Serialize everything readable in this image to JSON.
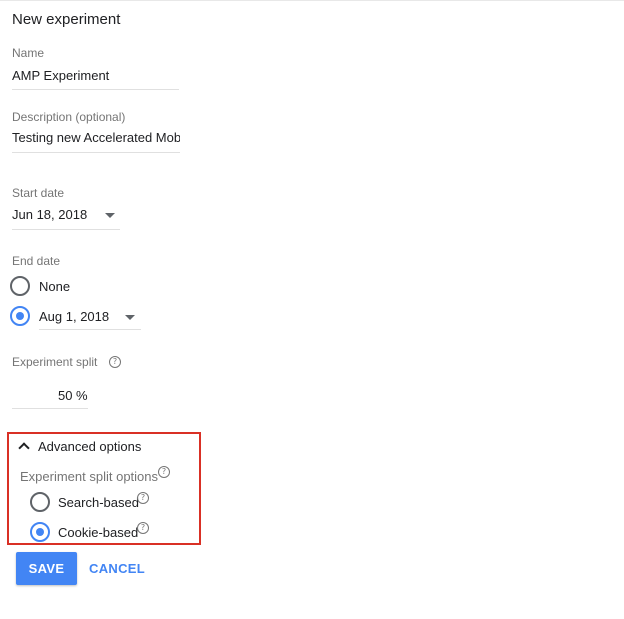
{
  "page": {
    "title": "New experiment"
  },
  "name": {
    "label": "Name",
    "value": "AMP Experiment"
  },
  "description": {
    "label": "Description (optional)",
    "value": "Testing new Accelerated Mobil"
  },
  "start_date": {
    "label": "Start date",
    "value": "Jun 18, 2018"
  },
  "end_date": {
    "label": "End date",
    "options": [
      {
        "label": "None",
        "selected": false
      },
      {
        "label": "Aug 1, 2018",
        "selected": true
      }
    ]
  },
  "split": {
    "label": "Experiment split",
    "value": "50",
    "unit": "%"
  },
  "advanced": {
    "toggle_label": "Advanced options",
    "split_options_label": "Experiment split options",
    "options": [
      {
        "label": "Search-based",
        "selected": false
      },
      {
        "label": "Cookie-based",
        "selected": true
      }
    ]
  },
  "actions": {
    "save_label": "SAVE",
    "cancel_label": "CANCEL"
  },
  "colors": {
    "accent": "#4285f4",
    "highlight_border": "#d93025"
  }
}
